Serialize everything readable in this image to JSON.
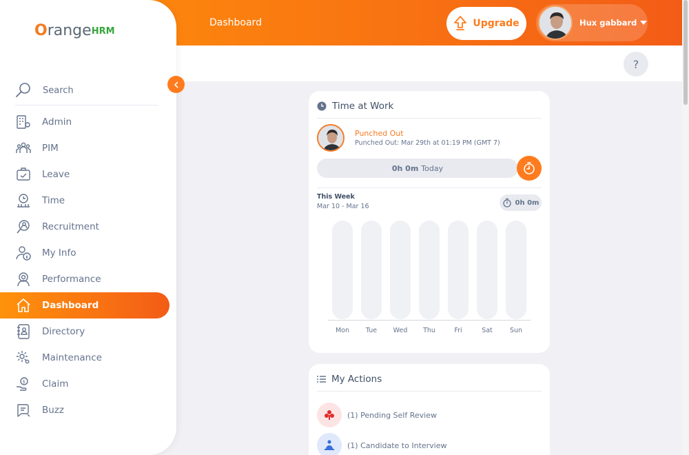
{
  "topbar": {
    "title": "Dashboard",
    "upgrade_label": "Upgrade",
    "user_name": "Hux gabbard"
  },
  "help": {
    "label": "?"
  },
  "sidebar": {
    "logo": {
      "o": "O",
      "range": "range",
      "hrm": "HRM"
    },
    "search_label": "Search",
    "items": [
      {
        "label": "Admin",
        "icon": "admin-icon"
      },
      {
        "label": "PIM",
        "icon": "pim-icon"
      },
      {
        "label": "Leave",
        "icon": "leave-icon"
      },
      {
        "label": "Time",
        "icon": "time-icon"
      },
      {
        "label": "Recruitment",
        "icon": "recruitment-icon"
      },
      {
        "label": "My Info",
        "icon": "my-info-icon"
      },
      {
        "label": "Performance",
        "icon": "performance-icon"
      },
      {
        "label": "Dashboard",
        "icon": "home-icon",
        "active": true
      },
      {
        "label": "Directory",
        "icon": "directory-icon"
      },
      {
        "label": "Maintenance",
        "icon": "maintenance-icon"
      },
      {
        "label": "Claim",
        "icon": "claim-icon"
      },
      {
        "label": "Buzz",
        "icon": "buzz-icon"
      }
    ]
  },
  "time_at_work": {
    "title": "Time at Work",
    "status": "Punched Out",
    "detail": "Punched Out: Mar 29th at 01:19 PM (GMT 7)",
    "today_hours": "0h 0m",
    "today_label": "Today",
    "week_label": "This Week",
    "week_range": "Mar 10 - Mar 16",
    "week_total": "0h 0m",
    "days": [
      "Mon",
      "Tue",
      "Wed",
      "Thu",
      "Fri",
      "Sat",
      "Sun"
    ]
  },
  "my_actions": {
    "title": "My Actions",
    "items": [
      {
        "label": "(1) Pending Self Review",
        "color": "#fde4e4",
        "icon_color": "#e12d2d"
      },
      {
        "label": "(1) Candidate to Interview",
        "color": "#e0e8fb",
        "icon_color": "#3a6fd8"
      }
    ]
  },
  "colors": {
    "accent": "#ff7b1d",
    "accent_dark": "#f35c17",
    "text": "#64728c"
  }
}
